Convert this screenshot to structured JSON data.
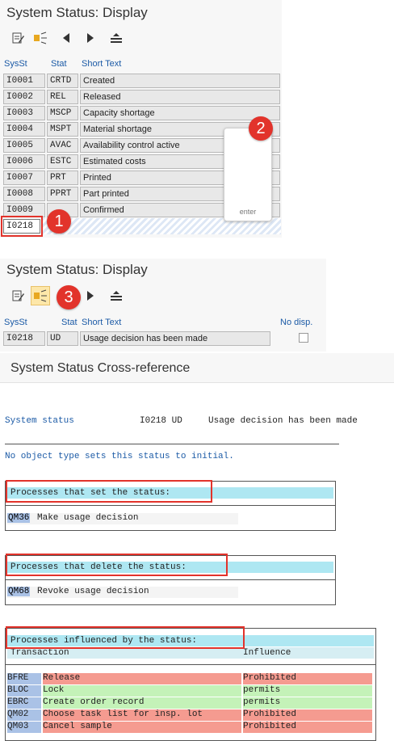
{
  "panel1": {
    "title": "System Status: Display",
    "headers": {
      "sysst": "SysSt",
      "stat": "Stat",
      "short": "Short Text"
    },
    "rows": [
      {
        "sysst": "I0001",
        "stat": "CRTD",
        "text": "Created"
      },
      {
        "sysst": "I0002",
        "stat": "REL",
        "text": "Released"
      },
      {
        "sysst": "I0003",
        "stat": "MSCP",
        "text": "Capacity shortage"
      },
      {
        "sysst": "I0004",
        "stat": "MSPT",
        "text": "Material shortage"
      },
      {
        "sysst": "I0005",
        "stat": "AVAC",
        "text": "Availability control active"
      },
      {
        "sysst": "I0006",
        "stat": "ESTC",
        "text": "Estimated costs"
      },
      {
        "sysst": "I0007",
        "stat": "PRT",
        "text": "Printed"
      },
      {
        "sysst": "I0008",
        "stat": "PPRT",
        "text": "Part printed"
      },
      {
        "sysst": "I0009",
        "stat": "",
        "text": "Confirmed"
      }
    ],
    "input_value": "I0218",
    "enter_key": "enter",
    "badge1": "1",
    "badge2": "2"
  },
  "panel2": {
    "title": "System Status: Display",
    "headers": {
      "sysst": "SysSt",
      "stat": "Stat",
      "short": "Short Text",
      "nodisp": "No disp."
    },
    "row": {
      "sysst": "I0218",
      "stat": "UD",
      "text": "Usage decision has been made"
    },
    "badge3": "3"
  },
  "panel3": {
    "title": "System Status Cross-reference",
    "status_label": "System status",
    "status_code": "I0218 UD",
    "status_text": "Usage decision has been made",
    "initial_note": "No object type sets this status to initial.",
    "set_header": "Processes that set the status:",
    "set_rows": [
      {
        "code": "QM36",
        "text": "Make usage decision"
      }
    ],
    "delete_header": "Processes that delete the status:",
    "delete_rows": [
      {
        "code": "QM68",
        "text": "Revoke usage decision"
      }
    ],
    "influenced_header": "Processes influenced by the status:",
    "col_transaction": "Transaction",
    "col_influence": "Influence",
    "influenced_rows": [
      {
        "code": "BFRE",
        "text": "Release",
        "influence": "Prohibited",
        "type": "prohibited"
      },
      {
        "code": "BLOC",
        "text": "Lock",
        "influence": "permits",
        "type": "permits"
      },
      {
        "code": "EBRC",
        "text": "Create order record",
        "influence": "permits",
        "type": "permits"
      },
      {
        "code": "QM02",
        "text": "Choose task list for insp. lot",
        "influence": "Prohibited",
        "type": "prohibited"
      },
      {
        "code": "QM03",
        "text": "Cancel sample",
        "influence": "Prohibited",
        "type": "prohibited"
      }
    ]
  },
  "colors": {
    "badge": "#e2332b",
    "cyan": "#aee7f2",
    "prohibited": "#f59b90",
    "permits": "#c4f2b8",
    "code_bg": "#aac2e6",
    "link_blue": "#1b5aa6"
  },
  "icons": {
    "toolbar": [
      "edit-icon",
      "where-used-icon",
      "previous-icon",
      "next-icon",
      "align-icon"
    ]
  }
}
